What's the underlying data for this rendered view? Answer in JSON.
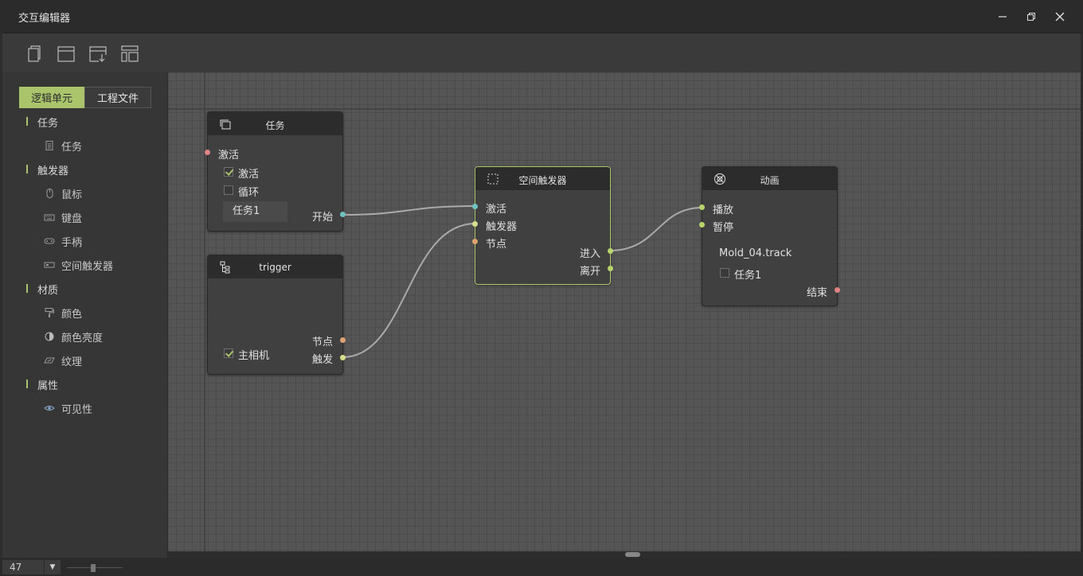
{
  "window": {
    "title": "交互编辑器"
  },
  "tabs": {
    "logic": "逻辑单元",
    "project": "工程文件"
  },
  "sidebar": {
    "categories": [
      {
        "label": "任务",
        "items": [
          {
            "label": "任务",
            "icon": "document-icon"
          }
        ]
      },
      {
        "label": "触发器",
        "items": [
          {
            "label": "鼠标",
            "icon": "mouse-icon"
          },
          {
            "label": "键盘",
            "icon": "keyboard-icon"
          },
          {
            "label": "手柄",
            "icon": "gamepad-icon"
          },
          {
            "label": "空间触发器",
            "icon": "space-trigger-icon"
          }
        ]
      },
      {
        "label": "材质",
        "items": [
          {
            "label": "颜色",
            "icon": "paint-roller-icon"
          },
          {
            "label": "颜色亮度",
            "icon": "brightness-icon"
          },
          {
            "label": "纹理",
            "icon": "texture-icon"
          }
        ]
      },
      {
        "label": "属性",
        "items": [
          {
            "label": "可见性",
            "icon": "eye-icon"
          }
        ]
      }
    ]
  },
  "nodes": {
    "task": {
      "title": "任务",
      "in_activate": "激活",
      "chk_activate": "激活",
      "chk_loop": "循环",
      "field": "任务1",
      "out_start": "开始"
    },
    "trigger": {
      "title": "trigger",
      "chk_camera": "主相机",
      "out_node": "节点",
      "out_trigger": "触发"
    },
    "space": {
      "title": "空间触发器",
      "in_activate": "激活",
      "in_trigger": "触发器",
      "in_node": "节点",
      "out_enter": "进入",
      "out_leave": "离开"
    },
    "anim": {
      "title": "动画",
      "in_play": "播放",
      "in_pause": "暂停",
      "track": "Mold_04.track",
      "chk_task": "任务1",
      "out_end": "结束"
    }
  },
  "colors": {
    "accent": "#aac46c",
    "port_red": "#e08383",
    "port_teal": "#6fc2c0",
    "port_yellow": "#d9dd8e",
    "port_orange": "#e0a070",
    "port_green": "#b8d46c"
  },
  "footer": {
    "zoom": "47"
  }
}
